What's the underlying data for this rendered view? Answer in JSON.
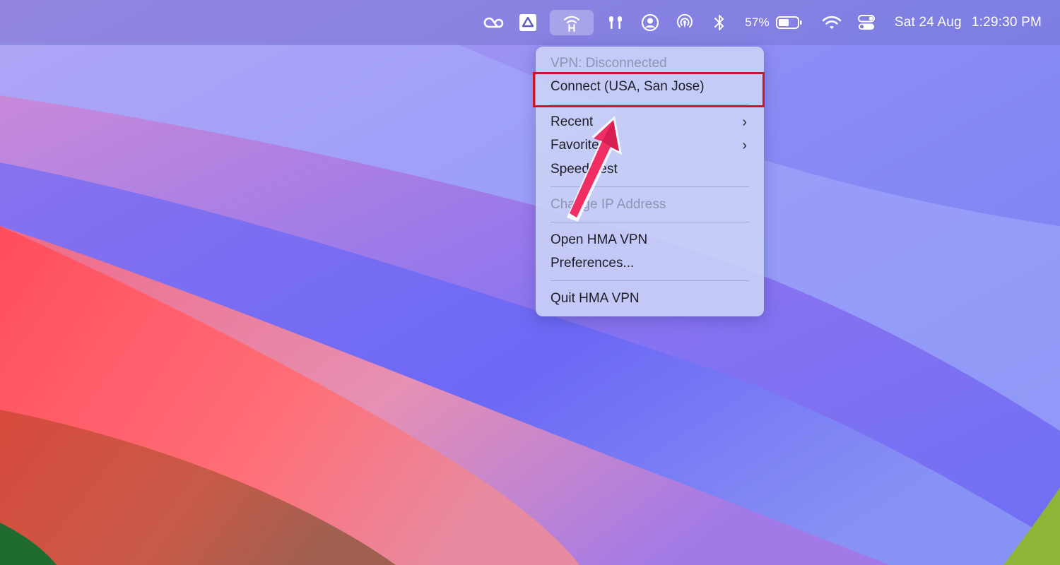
{
  "colors": {
    "menubar": "#7674d2",
    "menu_background": "#cad2f6",
    "highlight_border": "#c81628",
    "arrow": "#ef2f63"
  },
  "menubar": {
    "icons": [
      "creative-cloud-icon",
      "drive-icon",
      "hma-vpn-icon",
      "airpods-icon",
      "user-icon",
      "airdrop-icon",
      "bluetooth-icon"
    ],
    "battery_percent": "57%",
    "battery_level": 0.57,
    "date": "Sat 24 Aug",
    "time": "1:29:30 PM"
  },
  "menu": {
    "status": "VPN: Disconnected",
    "connect": "Connect (USA, San Jose)",
    "recent": "Recent",
    "favorites": "Favorites",
    "speed_test": "Speed Test",
    "change_ip": "Change IP Address",
    "open_app": "Open HMA VPN",
    "preferences": "Preferences...",
    "quit": "Quit HMA VPN"
  }
}
